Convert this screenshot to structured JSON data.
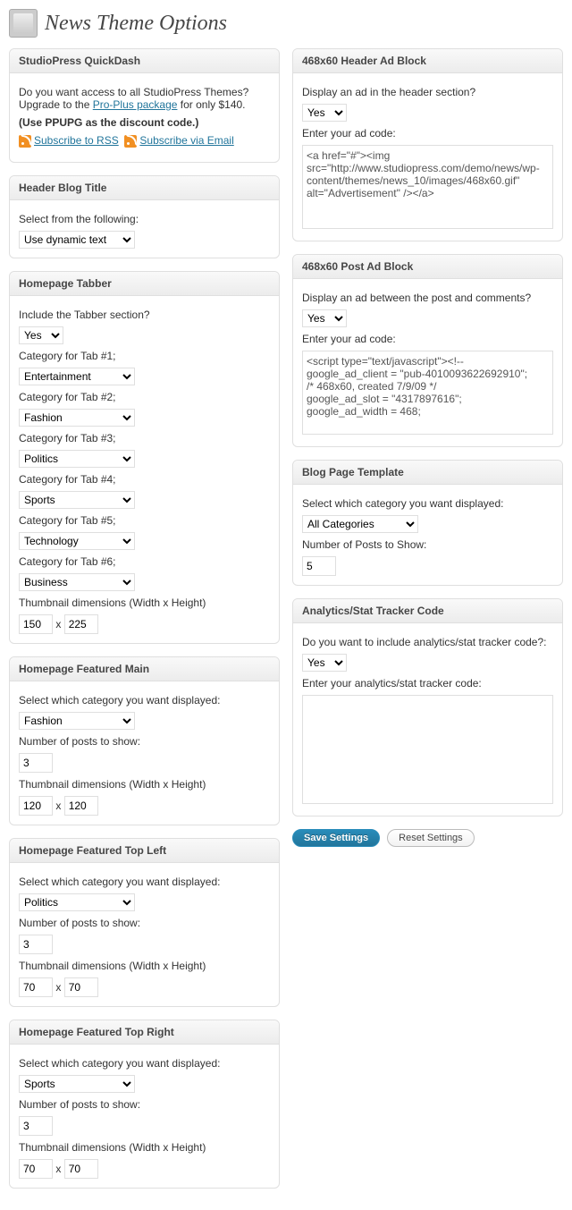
{
  "page_title": "News Theme Options",
  "quickdash": {
    "title": "StudioPress QuickDash",
    "text1": "Do you want access to all StudioPress Themes? Upgrade to the ",
    "link1": "Pro-Plus package",
    "text2": " for only $140.",
    "discount": "(Use PPUPG as the discount code.)",
    "rss_label": "Subscribe to RSS",
    "email_label": "Subscribe via Email"
  },
  "header_blog": {
    "title": "Header Blog Title",
    "label": "Select from the following:",
    "value": "Use dynamic text"
  },
  "tabber": {
    "title": "Homepage Tabber",
    "include_label": "Include the Tabber section?",
    "include_value": "Yes",
    "cat1_label": "Category for Tab #1;",
    "cat1_value": "Entertainment",
    "cat2_label": "Category for Tab #2;",
    "cat2_value": "Fashion",
    "cat3_label": "Category for Tab #3;",
    "cat3_value": "Politics",
    "cat4_label": "Category for Tab #4;",
    "cat4_value": "Sports",
    "cat5_label": "Category for Tab #5;",
    "cat5_value": "Technology",
    "cat6_label": "Category for Tab #6;",
    "cat6_value": "Business",
    "thumb_label": "Thumbnail dimensions (Width x Height)",
    "thumb_w": "150",
    "thumb_x": "x",
    "thumb_h": "225"
  },
  "featured_main": {
    "title": "Homepage Featured Main",
    "cat_label": "Select which category you want displayed:",
    "cat_value": "Fashion",
    "num_label": "Number of posts to show:",
    "num_value": "3",
    "thumb_label": "Thumbnail dimensions (Width x Height)",
    "thumb_w": "120",
    "thumb_x": "x",
    "thumb_h": "120"
  },
  "featured_top_left": {
    "title": "Homepage Featured Top Left",
    "cat_label": "Select which category you want displayed:",
    "cat_value": "Politics",
    "num_label": "Number of posts to show:",
    "num_value": "3",
    "thumb_label": "Thumbnail dimensions (Width x Height)",
    "thumb_w": "70",
    "thumb_x": "x",
    "thumb_h": "70"
  },
  "featured_top_right": {
    "title": "Homepage Featured Top Right",
    "cat_label": "Select which category you want displayed:",
    "cat_value": "Sports",
    "num_label": "Number of posts to show:",
    "num_value": "3",
    "thumb_label": "Thumbnail dimensions (Width x Height)",
    "thumb_w": "70",
    "thumb_x": "x",
    "thumb_h": "70"
  },
  "header_ad": {
    "title": "468x60 Header Ad Block",
    "display_label": "Display an ad in the header section?",
    "display_value": "Yes",
    "code_label": "Enter your ad code:",
    "code_value": "<a href=\"#\"><img src=\"http://www.studiopress.com/demo/news/wp-content/themes/news_10/images/468x60.gif\" alt=\"Advertisement\" /></a>"
  },
  "post_ad": {
    "title": "468x60 Post Ad Block",
    "display_label": "Display an ad between the post and comments?",
    "display_value": "Yes",
    "code_label": "Enter your ad code:",
    "code_value": "<script type=\"text/javascript\"><!--\ngoogle_ad_client = \"pub-4010093622692910\";\n/* 468x60, created 7/9/09 */\ngoogle_ad_slot = \"4317897616\";\ngoogle_ad_width = 468;"
  },
  "blog_template": {
    "title": "Blog Page Template",
    "cat_label": "Select which category you want displayed:",
    "cat_value": "All Categories",
    "num_label": "Number of Posts to Show:",
    "num_value": "5"
  },
  "analytics": {
    "title": "Analytics/Stat Tracker Code",
    "include_label": "Do you want to include analytics/stat tracker code?:",
    "include_value": "Yes",
    "code_label": "Enter your analytics/stat tracker code:",
    "code_value": ""
  },
  "buttons": {
    "save": "Save Settings",
    "reset": "Reset Settings"
  }
}
